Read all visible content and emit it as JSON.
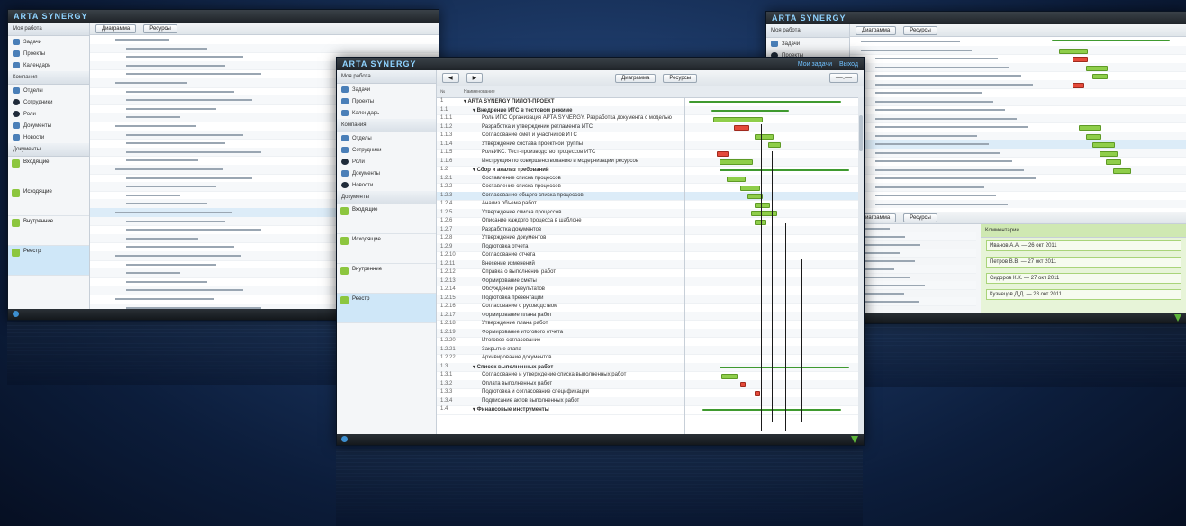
{
  "brand": {
    "logo": "ARTA SYNERGY",
    "accent": "#8fd3ff",
    "bar_green": "#8fce4a",
    "bar_red": "#e44a3a"
  },
  "center": {
    "header_right": [
      "Мои задачи",
      "Выход"
    ],
    "sidebar_title": "Моя работа",
    "sidebar_items": [
      "Задачи",
      "Проекты",
      "Календарь"
    ],
    "section2_title": "Компания",
    "section2_items": [
      "Отделы",
      "Сотрудники",
      "Роли",
      "Документы",
      "Новости"
    ],
    "section3_title": "Документы",
    "section3_items": [
      "Входящие",
      "Исходящие",
      "Внутренние",
      "Реестр"
    ],
    "toolbar": {
      "btn1": "Диаграмма",
      "btn2": "Ресурсы"
    },
    "col_num": "№",
    "col_name": "Наименование",
    "rows": [
      {
        "n": "1",
        "t": "ARTA SYNERGY ПИЛОТ-ПРОЕКТ",
        "lvl": 0
      },
      {
        "n": "1.1",
        "t": "Внедрение ИТС в тестовом режиме",
        "lvl": 1
      },
      {
        "n": "1.1.1",
        "t": "Роль ИПС Организация АРТА SYNERGY. Разработка документа с моделью",
        "lvl": 2
      },
      {
        "n": "1.1.2",
        "t": "Разработка и утверждение регламента ИТС",
        "lvl": 2
      },
      {
        "n": "1.1.3",
        "t": "Согласование смет и участников ИТС",
        "lvl": 2
      },
      {
        "n": "1.1.4",
        "t": "Утверждение состава проектной группы",
        "lvl": 2
      },
      {
        "n": "1.1.5",
        "t": "РольИКС. Тест-производство процессов ИТС",
        "lvl": 2
      },
      {
        "n": "1.1.6",
        "t": "Инструкция по совершенствованию и модернизации ресурсов",
        "lvl": 2
      },
      {
        "n": "1.2",
        "t": "Сбор и анализ требований",
        "lvl": 1
      },
      {
        "n": "1.2.1",
        "t": "Составление списка процессов",
        "lvl": 2
      },
      {
        "n": "1.2.2",
        "t": "Составление списка процессов",
        "lvl": 2
      },
      {
        "n": "1.2.3",
        "t": "Согласование общего списка процессов",
        "lvl": 2
      },
      {
        "n": "1.2.4",
        "t": "Анализ объема работ",
        "lvl": 2
      },
      {
        "n": "1.2.5",
        "t": "Утверждение списка процессов",
        "lvl": 2
      },
      {
        "n": "1.2.6",
        "t": "Описание каждого процесса в шаблоне",
        "lvl": 2
      },
      {
        "n": "1.2.7",
        "t": "Разработка документов",
        "lvl": 2
      },
      {
        "n": "1.2.8",
        "t": "Утверждение документов",
        "lvl": 2
      },
      {
        "n": "1.2.9",
        "t": "Подготовка отчета",
        "lvl": 2
      },
      {
        "n": "1.2.10",
        "t": "Согласование отчета",
        "lvl": 2
      },
      {
        "n": "1.2.11",
        "t": "Внесение изменений",
        "lvl": 2
      },
      {
        "n": "1.2.12",
        "t": "Справка о выполнении работ",
        "lvl": 2
      },
      {
        "n": "1.2.13",
        "t": "Формирование сметы",
        "lvl": 2
      },
      {
        "n": "1.2.14",
        "t": "Обсуждение результатов",
        "lvl": 2
      },
      {
        "n": "1.2.15",
        "t": "Подготовка презентации",
        "lvl": 2
      },
      {
        "n": "1.2.16",
        "t": "Согласование с руководством",
        "lvl": 2
      },
      {
        "n": "1.2.17",
        "t": "Формирование плана работ",
        "lvl": 2
      },
      {
        "n": "1.2.18",
        "t": "Утверждение плана работ",
        "lvl": 2
      },
      {
        "n": "1.2.19",
        "t": "Формирование итогового отчета",
        "lvl": 2
      },
      {
        "n": "1.2.20",
        "t": "Итоговое согласование",
        "lvl": 2
      },
      {
        "n": "1.2.21",
        "t": "Закрытие этапа",
        "lvl": 2
      },
      {
        "n": "1.2.22",
        "t": "Архивирование документов",
        "lvl": 2
      },
      {
        "n": "1.3",
        "t": "Список выполненных работ",
        "lvl": 1
      },
      {
        "n": "1.3.1",
        "t": "Согласование и утверждение списка выполненных работ",
        "lvl": 2
      },
      {
        "n": "1.3.2",
        "t": "Оплата выполненных работ",
        "lvl": 2
      },
      {
        "n": "1.3.3",
        "t": "Подготовка и согласование спецификации",
        "lvl": 2
      },
      {
        "n": "1.3.4",
        "t": "Подписание актов выполненных работ",
        "lvl": 2
      },
      {
        "n": "1.4",
        "t": "Финансовые инструменты",
        "lvl": 1
      }
    ]
  },
  "left": {
    "sidebar_title": "Моя работа",
    "sidebar_items": [
      "Задачи",
      "Проекты",
      "Календарь"
    ],
    "section2_title": "Компания",
    "section2_items": [
      "Отделы",
      "Сотрудники",
      "Роли",
      "Документы",
      "Новости"
    ],
    "section3_title": "Документы",
    "section3_items": [
      "Входящие",
      "Исходящие",
      "Внутренние",
      "Реестр"
    ],
    "toolbar": {
      "btn1": "Диаграмма",
      "btn2": "Ресурсы"
    }
  },
  "right": {
    "toolbar": {
      "btn1": "Диаграмма",
      "btn2": "Ресурсы"
    },
    "comments_title": "Комментарии",
    "comments": [
      "Иванов А.А. — 26 окт 2011",
      "Петров В.В. — 27 окт 2011",
      "Сидоров К.К. — 27 окт 2011",
      "Кузнецов Д.Д. — 28 окт 2011"
    ]
  }
}
